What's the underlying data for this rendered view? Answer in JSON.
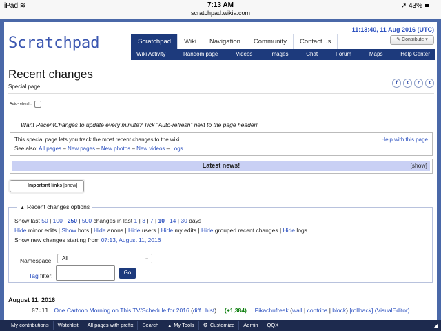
{
  "status_bar": {
    "device": "iPad",
    "time": "7:13 AM",
    "url": "scratchpad.wikia.com",
    "battery": "43%"
  },
  "header": {
    "logo": "Scratchpad",
    "clock": "11:13:40, 11 Aug 2016 (UTC)",
    "contribute": "Contribute"
  },
  "nav": {
    "tabs": [
      "Scratchpad",
      "Wiki",
      "Navigation",
      "Community",
      "Contact us"
    ],
    "sub_items": [
      "Wiki Activity",
      "Random page",
      "Videos",
      "Images",
      "Chat",
      "Forum",
      "Maps",
      "Help Center"
    ]
  },
  "page": {
    "title": "Recent changes",
    "subtitle": "Special page",
    "share_icons": [
      "f",
      "t",
      "r",
      "t"
    ],
    "autorefresh_label": "Auto-refresh:",
    "tip": "Want RecentChanges to update every minute? Tick “Auto-refresh” next to the page header!"
  },
  "infobox": {
    "intro": "This special page lets you track the most recent changes to the wiki.",
    "see_also_label": "See also:",
    "see_also": [
      "All pages",
      "New pages",
      "New photos",
      "New videos",
      "Logs"
    ],
    "help_link": "Help with this page"
  },
  "news": {
    "title": "Latest news!",
    "show": "[show]"
  },
  "important_links": {
    "label": "Important links",
    "show": "[show]"
  },
  "rc_options": {
    "legend": "Recent changes options",
    "show_last_label": "Show last",
    "counts": [
      "50",
      "100",
      "250",
      "500"
    ],
    "changes_in_last": "changes in last",
    "days": [
      "1",
      "3",
      "7",
      "10",
      "14",
      "30"
    ],
    "days_label": "days",
    "toggles": [
      {
        "action": "Hide",
        "text": "minor edits"
      },
      {
        "action": "Show",
        "text": "bots"
      },
      {
        "action": "Hide",
        "text": "anons"
      },
      {
        "action": "Hide",
        "text": "users"
      },
      {
        "action": "Hide",
        "text": "my edits"
      },
      {
        "action": "Hide",
        "text": "grouped recent changes"
      },
      {
        "action": "Hide",
        "text": "logs"
      }
    ],
    "starting_label": "Show new changes starting from",
    "starting_link": "07:13, August 11, 2016",
    "namespace_label": "Namespace:",
    "namespace_value": "All",
    "tag_link": "Tag",
    "tag_label": "filter:",
    "go": "Go"
  },
  "changes": {
    "date": "August 11, 2016",
    "entry": {
      "time": "07:11",
      "title": "One Cartoon Morning on This TV/Schedule for 2016",
      "diff": "diff",
      "hist": "hist",
      "delta": "(+1,384)",
      "user": "Pikachufreak",
      "wall": "wall",
      "contribs": "contribs",
      "block": "block",
      "rollback": "[rollback]",
      "editor": "(VisualEditor)"
    }
  },
  "toolbar": {
    "items": [
      "My contributions",
      "Watchlist",
      "All pages with prefix",
      "Search",
      "My Tools",
      "Customize",
      "Admin",
      "QQX"
    ]
  },
  "colors": {
    "nav_dark": "#1d3a7c",
    "link": "#2a4fbf",
    "news_bar": "#c9d0f4",
    "toolbar": "#1d2a4e"
  }
}
